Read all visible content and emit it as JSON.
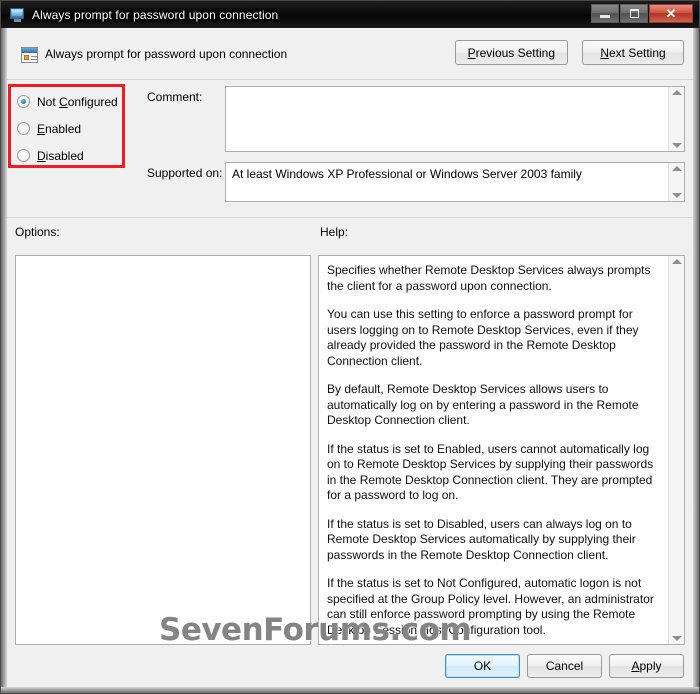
{
  "window": {
    "title": "Always prompt for password upon connection",
    "icon": "monitor-icon",
    "controls": {
      "minimize": "Minimize",
      "maximize": "Maximize",
      "close": "✕"
    }
  },
  "header": {
    "setting_title": "Always prompt for password upon connection",
    "icon": "policy-setting-icon",
    "previous_button": "Previous Setting",
    "previous_accel": "P",
    "next_button": "Next Setting",
    "next_accel": "N"
  },
  "state_options": {
    "highlight_color": "#ee1c25",
    "selected": "Not Configured",
    "items": [
      {
        "label": "Not Configured",
        "accel_before": "Not ",
        "accel": "C",
        "accel_after": "onfigured",
        "checked": true
      },
      {
        "label": "Enabled",
        "accel_before": "",
        "accel": "E",
        "accel_after": "nabled",
        "checked": false
      },
      {
        "label": "Disabled",
        "accel_before": "",
        "accel": "D",
        "accel_after": "isabled",
        "checked": false
      }
    ]
  },
  "comment": {
    "label": "Comment:",
    "value": "",
    "placeholder": ""
  },
  "supported_on": {
    "label": "Supported on:",
    "value": "At least Windows XP Professional or Windows Server 2003 family"
  },
  "options": {
    "label": "Options:",
    "content": ""
  },
  "help": {
    "label": "Help:",
    "paragraphs": [
      "Specifies whether Remote Desktop Services always prompts the client for a password upon connection.",
      "You can use this setting to enforce a password prompt for users logging on to Remote Desktop Services, even if they already provided the password in the Remote Desktop Connection client.",
      "By default, Remote Desktop Services allows users to automatically log on by entering a password in the Remote Desktop Connection client.",
      "If the status is set to Enabled, users cannot automatically log on to Remote Desktop Services by supplying their passwords in the Remote Desktop Connection client. They are prompted for a password to log on.",
      "If the status is set to Disabled, users can always log on to Remote Desktop Services automatically by supplying their passwords in the Remote Desktop Connection client.",
      "If the status is set to Not Configured, automatic logon is not specified at the Group Policy level. However, an administrator can still enforce password prompting by using the Remote Desktop Session Host Configuration tool."
    ]
  },
  "footer": {
    "ok": "OK",
    "cancel": "Cancel",
    "apply": "Apply",
    "apply_accel": "A",
    "default_button": "OK"
  },
  "watermark": {
    "text": "SevenForums.com",
    "color": "#848484"
  }
}
